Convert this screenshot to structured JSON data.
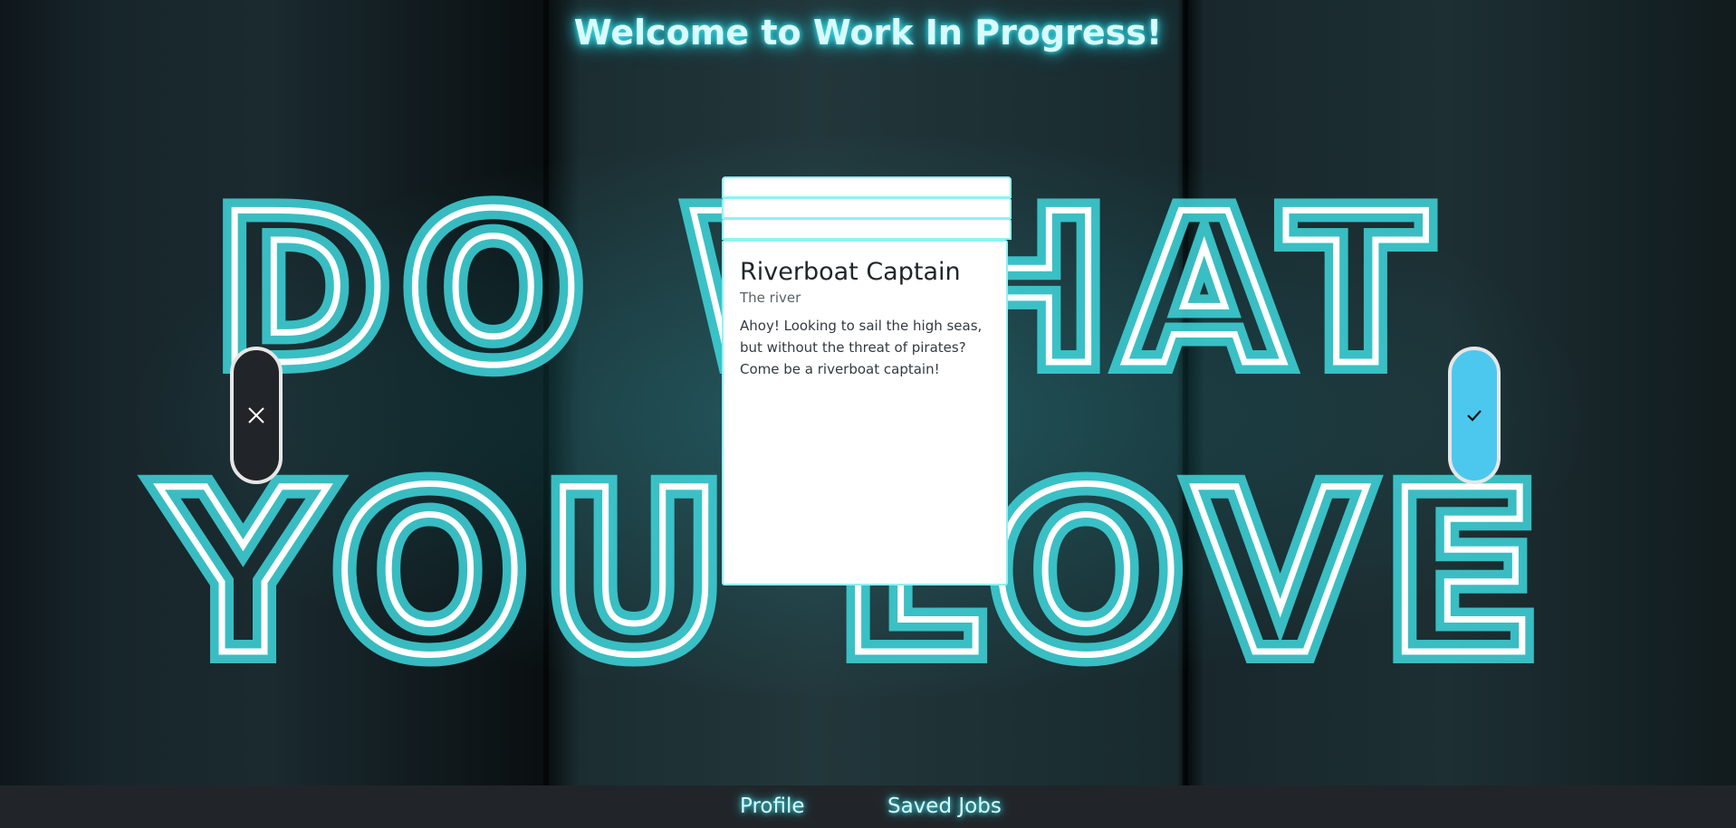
{
  "header": {
    "title": "Welcome to Work In Progress!"
  },
  "background": {
    "neon_line_1": "DO WHAT",
    "neon_line_2": "YOU LOVE",
    "neon_color": "#3fd7dc"
  },
  "card": {
    "title": "Riverboat Captain",
    "location": "The river",
    "description": "Ahoy! Looking to sail the high seas, but without the threat of pirates? Come be a riverboat captain!"
  },
  "actions": {
    "reject_icon": "close-icon",
    "accept_icon": "check-icon",
    "reject_color": "#212529",
    "accept_color": "#4cc8ef"
  },
  "nav": {
    "items": [
      {
        "label": "Profile"
      },
      {
        "label": "Saved Jobs"
      }
    ]
  }
}
